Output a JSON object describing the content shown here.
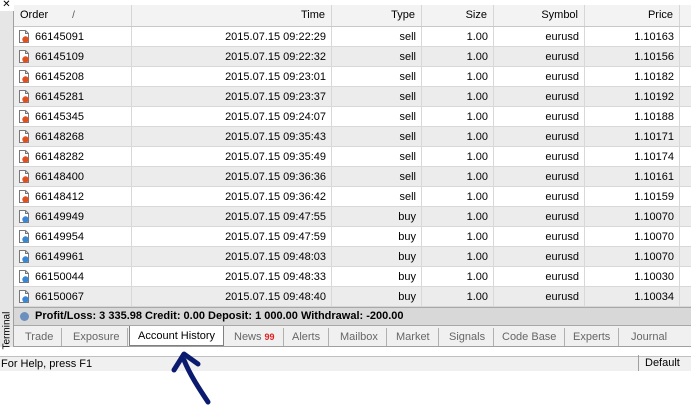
{
  "window": {
    "close_glyph": "✕",
    "side_label": "Terminal"
  },
  "table": {
    "columns": [
      "Order",
      "Time",
      "Type",
      "Size",
      "Symbol",
      "Price"
    ],
    "sort_indicator": "/",
    "rows": [
      {
        "order": "66145091",
        "time": "2015.07.15 09:22:29",
        "type": "sell",
        "size": "1.00",
        "symbol": "eurusd",
        "price": "1.10163",
        "icon": "sell-order-icon"
      },
      {
        "order": "66145109",
        "time": "2015.07.15 09:22:32",
        "type": "sell",
        "size": "1.00",
        "symbol": "eurusd",
        "price": "1.10156",
        "icon": "sell-order-icon"
      },
      {
        "order": "66145208",
        "time": "2015.07.15 09:23:01",
        "type": "sell",
        "size": "1.00",
        "symbol": "eurusd",
        "price": "1.10182",
        "icon": "sell-order-icon"
      },
      {
        "order": "66145281",
        "time": "2015.07.15 09:23:37",
        "type": "sell",
        "size": "1.00",
        "symbol": "eurusd",
        "price": "1.10192",
        "icon": "sell-order-icon"
      },
      {
        "order": "66145345",
        "time": "2015.07.15 09:24:07",
        "type": "sell",
        "size": "1.00",
        "symbol": "eurusd",
        "price": "1.10188",
        "icon": "sell-order-icon"
      },
      {
        "order": "66148268",
        "time": "2015.07.15 09:35:43",
        "type": "sell",
        "size": "1.00",
        "symbol": "eurusd",
        "price": "1.10171",
        "icon": "sell-order-icon"
      },
      {
        "order": "66148282",
        "time": "2015.07.15 09:35:49",
        "type": "sell",
        "size": "1.00",
        "symbol": "eurusd",
        "price": "1.10174",
        "icon": "sell-order-icon"
      },
      {
        "order": "66148400",
        "time": "2015.07.15 09:36:36",
        "type": "sell",
        "size": "1.00",
        "symbol": "eurusd",
        "price": "1.10161",
        "icon": "sell-order-icon"
      },
      {
        "order": "66148412",
        "time": "2015.07.15 09:36:42",
        "type": "sell",
        "size": "1.00",
        "symbol": "eurusd",
        "price": "1.10159",
        "icon": "sell-order-icon"
      },
      {
        "order": "66149949",
        "time": "2015.07.15 09:47:55",
        "type": "buy",
        "size": "1.00",
        "symbol": "eurusd",
        "price": "1.10070",
        "icon": "buy-order-icon"
      },
      {
        "order": "66149954",
        "time": "2015.07.15 09:47:59",
        "type": "buy",
        "size": "1.00",
        "symbol": "eurusd",
        "price": "1.10070",
        "icon": "buy-order-icon"
      },
      {
        "order": "66149961",
        "time": "2015.07.15 09:48:03",
        "type": "buy",
        "size": "1.00",
        "symbol": "eurusd",
        "price": "1.10070",
        "icon": "buy-order-icon"
      },
      {
        "order": "66150044",
        "time": "2015.07.15 09:48:33",
        "type": "buy",
        "size": "1.00",
        "symbol": "eurusd",
        "price": "1.10030",
        "icon": "buy-order-icon"
      },
      {
        "order": "66150067",
        "time": "2015.07.15 09:48:40",
        "type": "buy",
        "size": "1.00",
        "symbol": "eurusd",
        "price": "1.10034",
        "icon": "buy-order-icon"
      }
    ]
  },
  "summary": {
    "text": "Profit/Loss: 3 335.98  Credit: 0.00  Deposit: 1 000.00  Withdrawal: -200.00",
    "icon": "summary-info-icon"
  },
  "tabs": [
    {
      "label": "Trade"
    },
    {
      "label": "Exposure"
    },
    {
      "label": "Account History",
      "active": true
    },
    {
      "label": "News",
      "badge": "99"
    },
    {
      "label": "Alerts"
    },
    {
      "label": "Mailbox"
    },
    {
      "label": "Market"
    },
    {
      "label": "Signals"
    },
    {
      "label": "Code Base"
    },
    {
      "label": "Experts"
    },
    {
      "label": "Journal"
    }
  ],
  "status_bar": {
    "help": "For Help, press F1",
    "profile": "Default"
  },
  "annotation": {
    "icon": "arrow-up-icon",
    "color": "#0a1a6e"
  },
  "colors": {
    "sell_icon": "#e05020",
    "buy_icon": "#3a86d0",
    "active_tab_border": "#808080"
  }
}
